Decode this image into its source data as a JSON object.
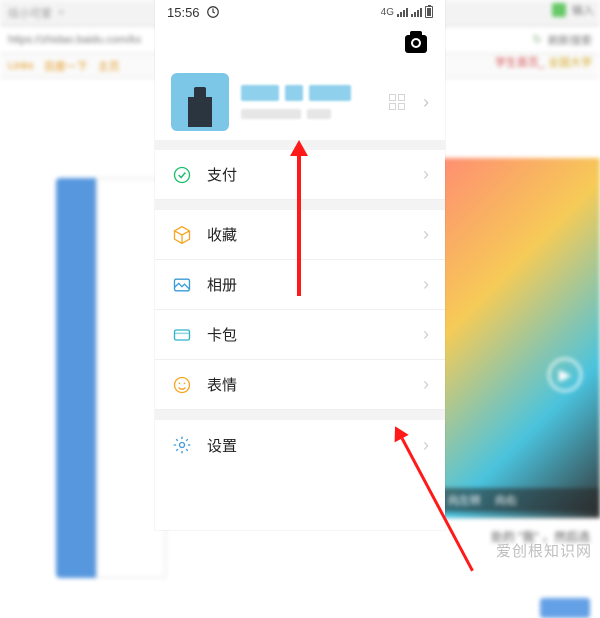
{
  "browser": {
    "tab_title": "炫小可爱",
    "address": "https://zhidao.baidu.com/kx",
    "bookmarks": [
      "Links",
      "百度一下",
      "主页"
    ],
    "right_tab_hint": "输入",
    "refresh_label": "刷新搜索",
    "bookmarks_right": [
      "学生首页_",
      "全国大学"
    ],
    "video_caption_left": "向左转",
    "video_caption_right": "向右",
    "side_text": "处的 \"我\" ，然后选"
  },
  "status": {
    "time": "15:56",
    "network_label": "4G"
  },
  "menu": {
    "pay": "支付",
    "favorites": "收藏",
    "album": "相册",
    "cards": "卡包",
    "emoji": "表情",
    "settings": "设置"
  },
  "watermark": "爱创根知识网"
}
